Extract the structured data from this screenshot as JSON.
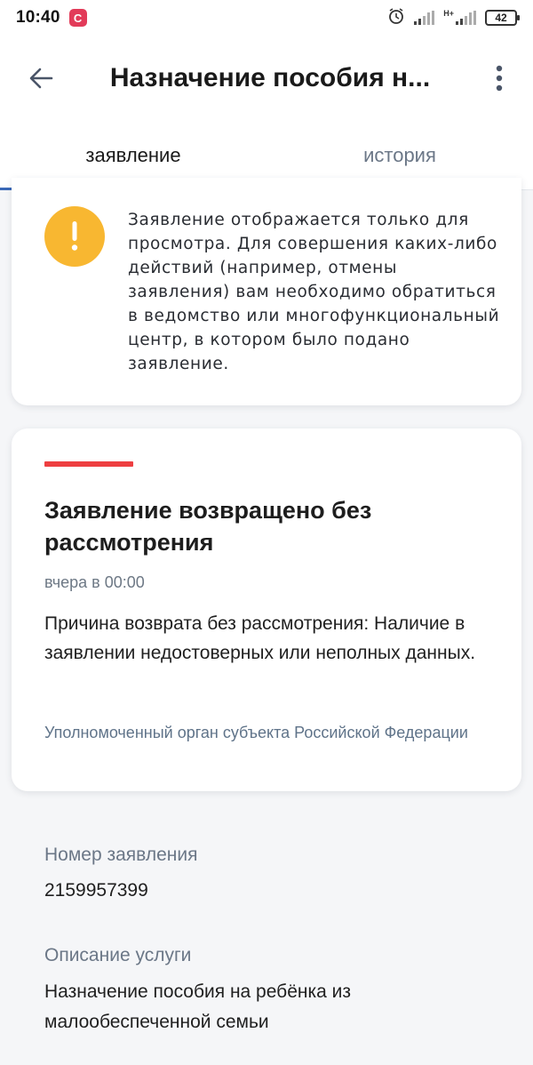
{
  "status_bar": {
    "time": "10:40",
    "app_icon_letter": "C",
    "network": "H+",
    "battery": "42"
  },
  "header": {
    "title": "Назначение пособия н...",
    "back_icon": "arrow-left-icon",
    "menu_icon": "more-vertical-icon"
  },
  "tabs": [
    {
      "label": "заявление",
      "active": true
    },
    {
      "label": "история",
      "active": false
    }
  ],
  "notice": {
    "icon": "exclamation-icon",
    "color": "#f8b731",
    "text": "Заявление отображается только для просмотра. Для совершения каких-либо действий (например, отмены заявления) вам необходимо обратиться в ведомство или многофункциональный центр, в котором было подано заявление."
  },
  "status_card": {
    "accent_color": "#ee3f41",
    "title": "Заявление возвращено без рассмотрения",
    "date": "вчера в 00:00",
    "reason": "Причина возврата без рассмотрения: Наличие в заявлении недостоверных или неполных данных.",
    "organization": "Уполномоченный орган субъекта Российской Федерации"
  },
  "details": {
    "number_label": "Номер заявления",
    "number_value": "2159957399",
    "service_label": "Описание услуги",
    "service_value": "Назначение пособия на ребёнка из малообеспеченной семьи"
  }
}
